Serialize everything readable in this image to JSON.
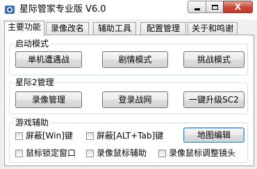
{
  "window": {
    "title": "星际管家专业版 V6.0",
    "icon": "app-logo-icon",
    "controls": {
      "minimize": "minimize-icon",
      "maximize": "maximize-icon",
      "close": "close-icon",
      "close_glyph": "X"
    }
  },
  "tabs": [
    {
      "label": "主要功能",
      "active": true
    },
    {
      "label": "录像改名",
      "active": false
    },
    {
      "label": "辅助工具",
      "active": false
    },
    {
      "label": "配置管理",
      "active": false
    },
    {
      "label": "关于和鸣谢",
      "active": false
    }
  ],
  "groups": {
    "launch": {
      "title": "启动模式",
      "buttons": [
        "单机遭遇战",
        "剧情模式",
        "挑战模式"
      ]
    },
    "sc2": {
      "title": "星际2管理",
      "buttons": [
        "录像管理",
        "登录战网",
        "一键升级SC2"
      ]
    },
    "assist": {
      "title": "游戏辅助",
      "checkboxes": [
        {
          "label": "屏蔽[Win]键",
          "checked": false
        },
        {
          "label": "屏蔽[ALT+Tab]键",
          "checked": false
        },
        {
          "label": "鼠标锁定窗口",
          "checked": false
        },
        {
          "label": "录像鼠标辅助",
          "checked": false
        },
        {
          "label": "录像鼠标调整镜头",
          "checked": false
        }
      ],
      "map_editor_button": "地图编辑"
    }
  },
  "colors": {
    "close_button": "#c74735",
    "focus_border": "#3c7fb1",
    "window_bg": "#f0f0f0",
    "panel_bg": "#ffffff"
  }
}
